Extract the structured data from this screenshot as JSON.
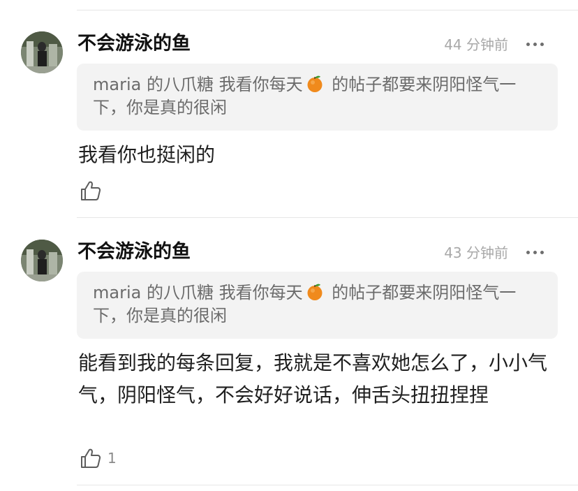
{
  "comments": [
    {
      "username": "不会游泳的鱼",
      "time": "44 分钟前",
      "quote_before": "maria 的八爪糖 我看你每天",
      "quote_emoji": "orange-emoji",
      "quote_after": " 的帖子都要来阴阳怪气一下，你是真的很闲",
      "text": "我看你也挺闲的",
      "likes": ""
    },
    {
      "username": "不会游泳的鱼",
      "time": "43 分钟前",
      "quote_before": "maria 的八爪糖 我看你每天",
      "quote_emoji": "orange-emoji",
      "quote_after": " 的帖子都要来阴阳怪气一下，你是真的很闲",
      "text": "能看到我的每条回复，我就是不喜欢她怎么了，小小气气，阴阳怪气，不会好好说话，伸舌头扭扭捏捏",
      "likes": "1"
    }
  ],
  "colors": {
    "username": "#111111",
    "timestamp": "#a8a8a8",
    "quote_bg": "#f3f3f3",
    "quote_text": "#6b6b6b",
    "body_text": "#1f1f1f",
    "divider": "#e6e6e6"
  }
}
